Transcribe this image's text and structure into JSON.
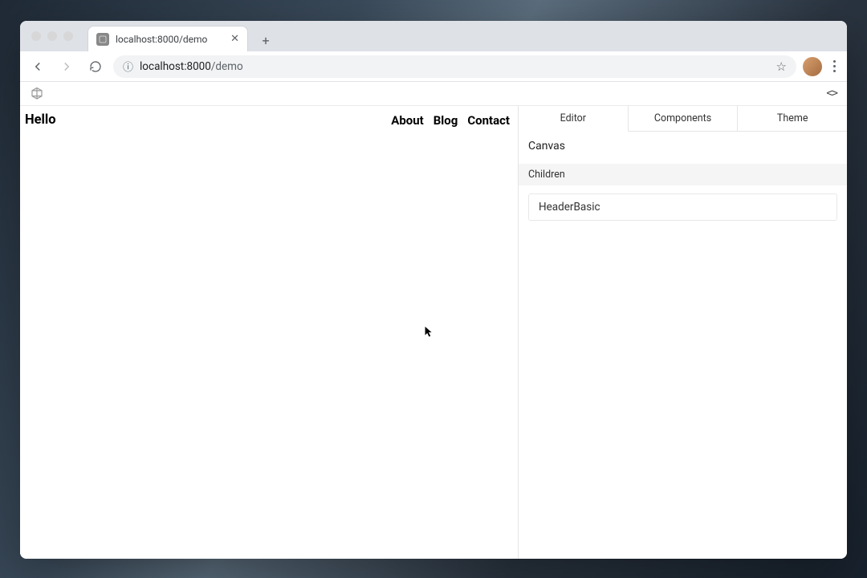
{
  "browser": {
    "tab_title": "localhost:8000/demo",
    "url": "localhost:8000/demo",
    "url_host_prefix": "localhost:8000",
    "url_path": "/demo"
  },
  "preview": {
    "title": "Hello",
    "nav": {
      "about": "About",
      "blog": "Blog",
      "contact": "Contact"
    }
  },
  "panel": {
    "tabs": {
      "editor": "Editor",
      "components": "Components",
      "theme": "Theme"
    },
    "active_tab": "Editor",
    "heading": "Canvas",
    "children_label": "Children",
    "children": {
      "0": "HeaderBasic"
    }
  }
}
